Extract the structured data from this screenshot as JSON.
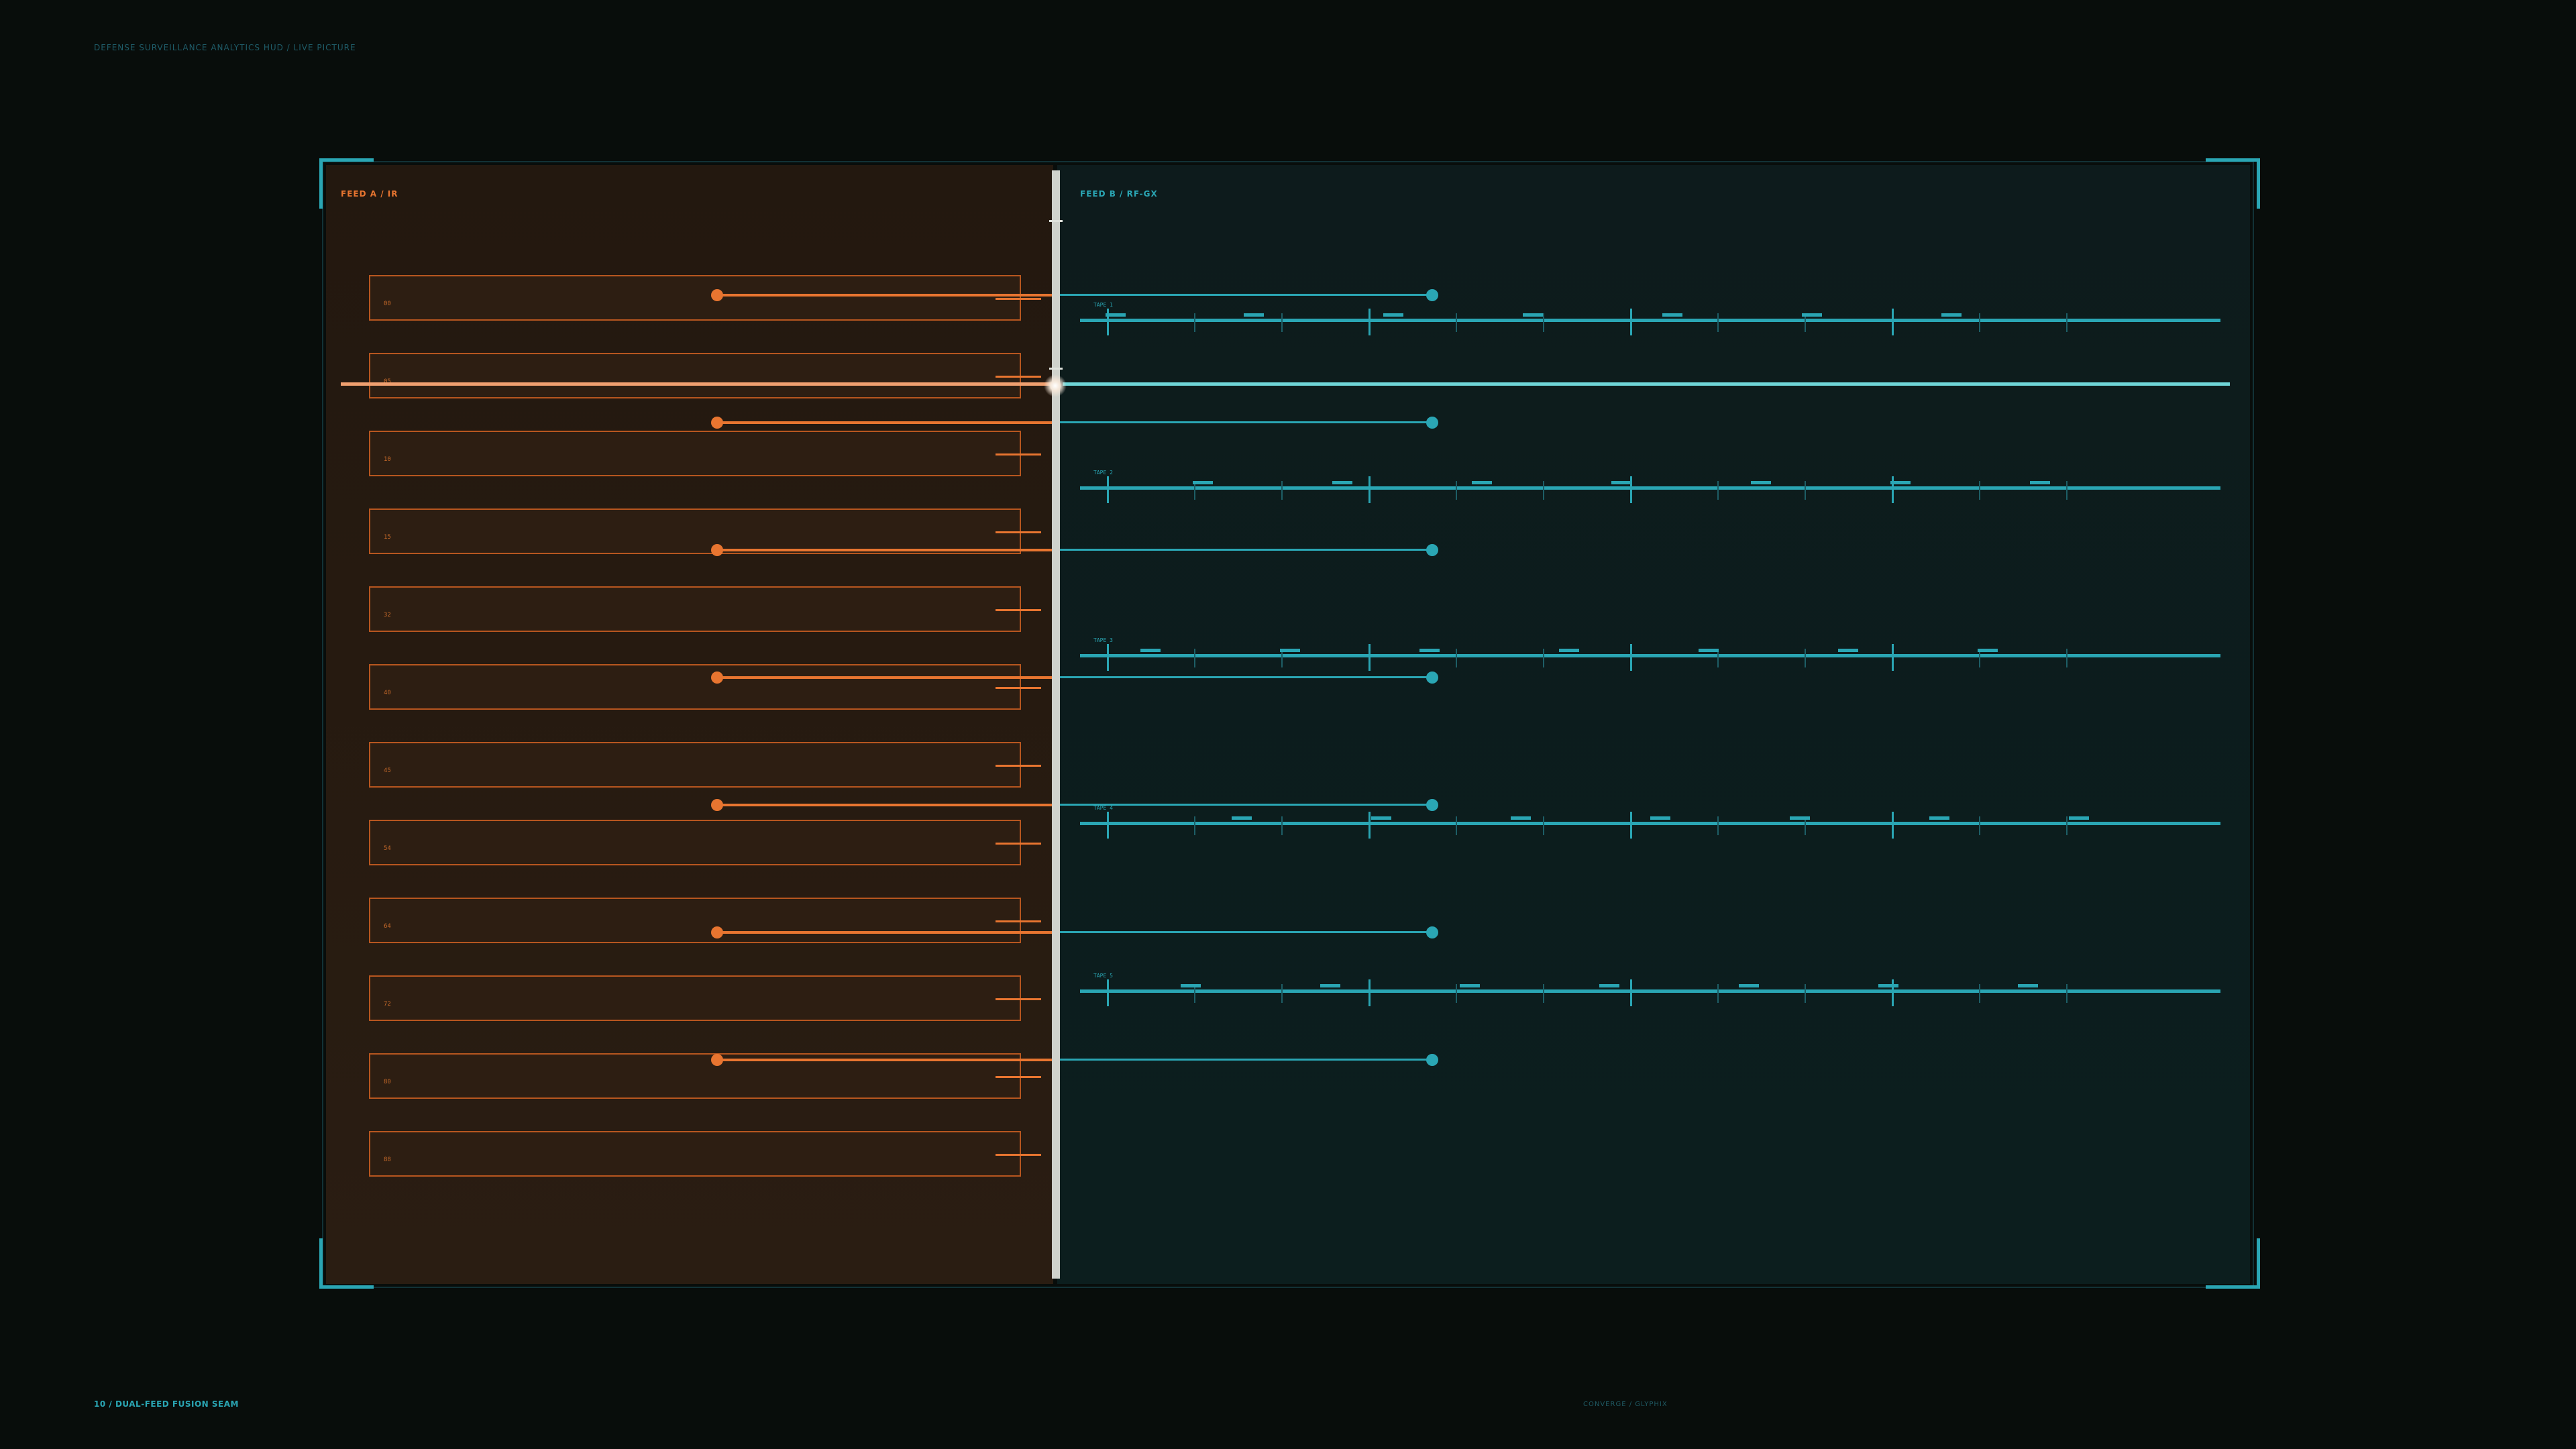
{
  "header": {
    "breadcrumb": "DEFENSE SURVEILLANCE ANALYTICS HUD  /  LIVE PICTURE"
  },
  "feed_a": {
    "title": "FEED A  /  IR",
    "rows": [
      "00",
      "05",
      "10",
      "15",
      "32",
      "40",
      "45",
      "54",
      "64",
      "72",
      "80",
      "88"
    ]
  },
  "feed_b": {
    "title": "FEED B  /  RF-GX",
    "tapes": [
      "TAPE 1",
      "TAPE 2",
      "TAPE 3",
      "TAPE 4",
      "TAPE 5"
    ]
  },
  "footer": {
    "left": "10 / DUAL-FEED FUSION SEAM",
    "center": "CONVERGE / GLYPHIX"
  },
  "colors": {
    "feed_a_accent": "#e87530",
    "feed_b_accent": "#2aa6b4",
    "seam": "#cfd2cc"
  }
}
